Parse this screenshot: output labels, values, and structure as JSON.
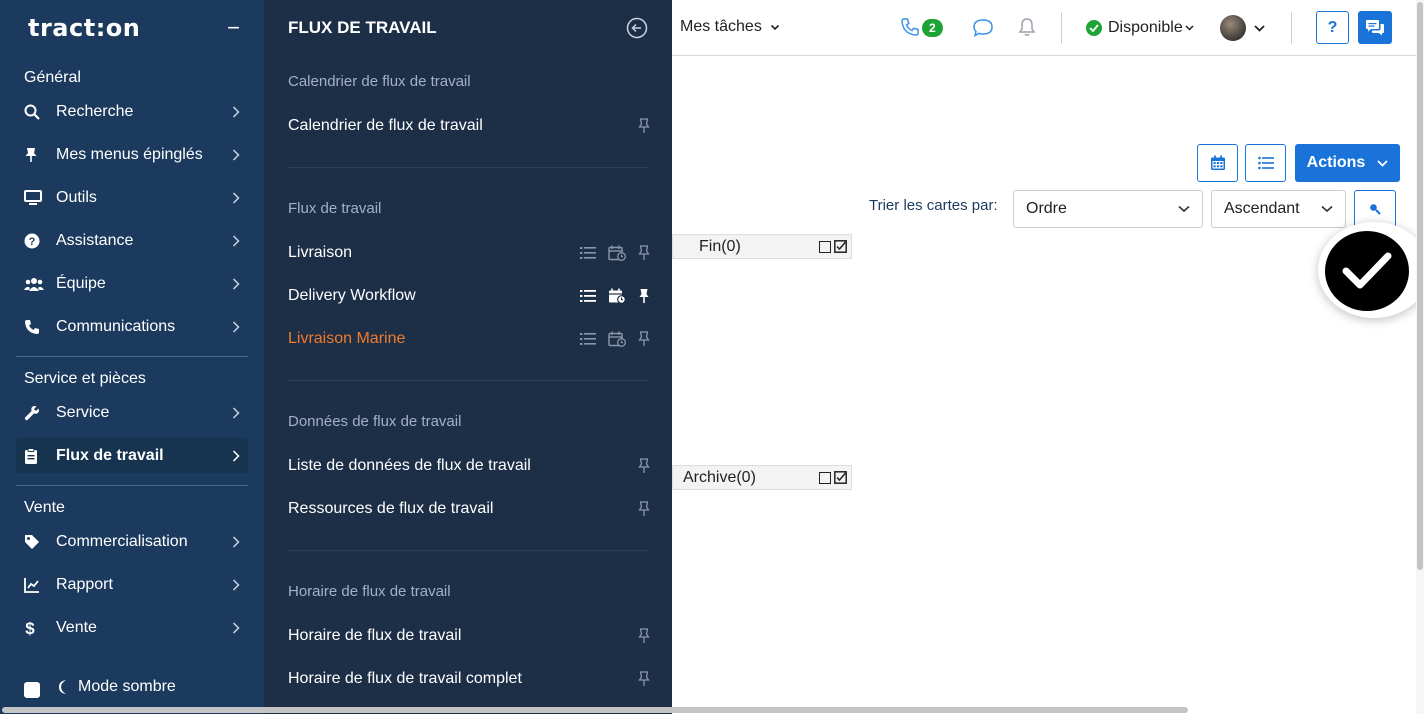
{
  "sidebar": {
    "logo": "tract:on",
    "collapse": "−",
    "sections": [
      {
        "title": "Général",
        "items": [
          {
            "label": "Recherche",
            "icon": "search-icon"
          },
          {
            "label": "Mes menus épinglés",
            "icon": "pin-icon"
          },
          {
            "label": "Outils",
            "icon": "monitor-icon"
          },
          {
            "label": "Assistance",
            "icon": "question-circle-icon"
          },
          {
            "label": "Équipe",
            "icon": "users-icon"
          },
          {
            "label": "Communications",
            "icon": "phone-icon"
          }
        ]
      },
      {
        "title": "Service et pièces",
        "items": [
          {
            "label": "Service",
            "icon": "wrench-icon"
          },
          {
            "label": "Flux de travail",
            "icon": "clipboard-icon",
            "active": true
          }
        ]
      },
      {
        "title": "Vente",
        "items": [
          {
            "label": "Commercialisation",
            "icon": "tag-icon"
          },
          {
            "label": "Rapport",
            "icon": "chart-line-icon"
          },
          {
            "label": "Vente",
            "icon": "dollar-icon"
          }
        ]
      }
    ],
    "dark_mode_label": "Mode sombre"
  },
  "flyout": {
    "title": "FLUX DE TRAVAIL",
    "groups": [
      {
        "title": "Calendrier de flux de travail",
        "items": [
          {
            "label": "Calendrier de flux de travail"
          }
        ]
      },
      {
        "title": "Flux de travail",
        "items": [
          {
            "label": "Livraison"
          },
          {
            "label": "Delivery Workflow"
          },
          {
            "label": "Livraison Marine"
          }
        ]
      },
      {
        "title": "Données de flux de travail",
        "items": [
          {
            "label": "Liste de données de flux de travail"
          },
          {
            "label": "Ressources de flux de travail"
          }
        ]
      },
      {
        "title": "Horaire de flux de travail",
        "items": [
          {
            "label": "Horaire de flux de travail"
          },
          {
            "label": "Horaire de flux de travail complet"
          }
        ]
      }
    ]
  },
  "topbar": {
    "my_tasks": "Mes tâches",
    "phone_badge": "2",
    "status": "Disponible",
    "help": "?"
  },
  "main": {
    "actions_label": "Actions",
    "sort_label": "Trier les cartes par:",
    "sort_field": "Ordre",
    "sort_order": "Ascendant",
    "columns": [
      {
        "title": "Fin(0)"
      },
      {
        "title": "Archive(0)"
      }
    ]
  },
  "colors": {
    "sidebar_bg": "#1c3a5e",
    "flyout_bg": "#1d2e47",
    "accent_blue": "#1a73d9",
    "highlight_orange": "#f07a2e",
    "status_green": "#1ea337"
  }
}
